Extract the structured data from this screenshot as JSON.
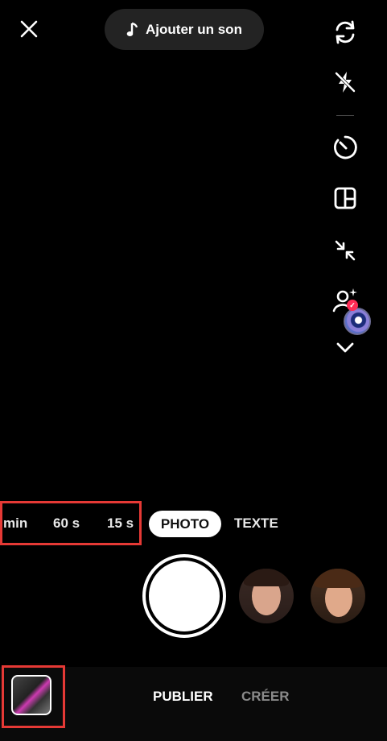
{
  "header": {
    "sound_label": "Ajouter un son"
  },
  "icons": {
    "close": "close-icon",
    "music_note": "music-note-icon",
    "flip_camera": "flip-camera-icon",
    "flash_off": "flash-off-icon",
    "timer": "timer-icon",
    "layout": "layout-grid-icon",
    "zoom": "collapse-arrows-icon",
    "beauty": "beauty-effect-icon",
    "more": "chevron-down-icon"
  },
  "modes": {
    "min_label": "min",
    "sixty_label": "60 s",
    "fifteen_label": "15 s",
    "photo_label": "PHOTO",
    "text_label": "TEXTE",
    "selected": "PHOTO"
  },
  "bottom": {
    "publish_label": "PUBLIER",
    "create_label": "CRÉER"
  },
  "colors": {
    "background": "#000000",
    "highlight": "#e53935",
    "badge": "#fe2c55"
  }
}
